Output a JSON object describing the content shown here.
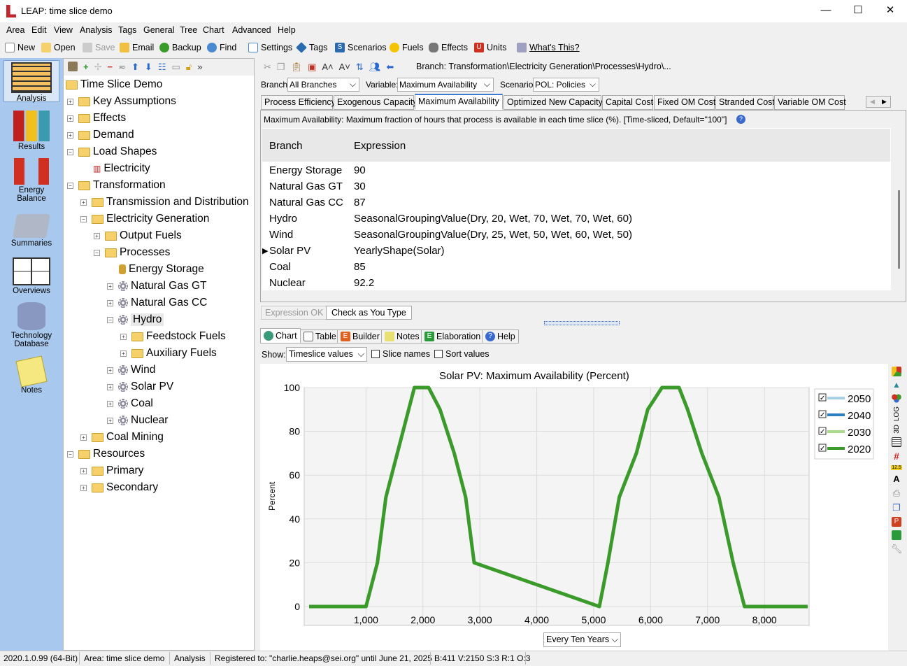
{
  "window": {
    "title": "LEAP: time slice demo",
    "minimize": "—",
    "maximize": "☐",
    "close": "✕"
  },
  "menu": [
    "Area",
    "Edit",
    "View",
    "Analysis",
    "Tags",
    "General",
    "Tree",
    "Chart",
    "Advanced",
    "Help"
  ],
  "toolbar": {
    "new": "New",
    "open": "Open",
    "save": "Save",
    "email": "Email",
    "backup": "Backup",
    "find": "Find",
    "settings": "Settings",
    "tags": "Tags",
    "scenarios": "Scenarios",
    "fuels": "Fuels",
    "effects": "Effects",
    "units": "Units",
    "whats_this": "What's This?"
  },
  "nav": {
    "analysis": "Analysis",
    "results": "Results",
    "energy_balance_1": "Energy",
    "energy_balance_2": "Balance",
    "summaries": "Summaries",
    "overviews": "Overviews",
    "techdb_1": "Technology",
    "techdb_2": "Database",
    "notes": "Notes"
  },
  "tree": {
    "root": "Time Slice Demo",
    "key_assumptions": "Key Assumptions",
    "effects": "Effects",
    "demand": "Demand",
    "load_shapes": "Load Shapes",
    "electricity": "Electricity",
    "transformation": "Transformation",
    "transmission": "Transmission and Distribution",
    "electricity_generation": "Electricity Generation",
    "output_fuels": "Output Fuels",
    "processes": "Processes",
    "energy_storage": "Energy Storage",
    "natural_gas_gt": "Natural Gas GT",
    "natural_gas_cc": "Natural Gas CC",
    "hydro": "Hydro",
    "feedstock_fuels": "Feedstock Fuels",
    "auxiliary_fuels": "Auxiliary Fuels",
    "wind": "Wind",
    "solar_pv": "Solar PV",
    "coal": "Coal",
    "nuclear": "Nuclear",
    "coal_mining": "Coal Mining",
    "resources": "Resources",
    "primary": "Primary",
    "secondary": "Secondary"
  },
  "breadcrumb": "Branch: Transformation\\Electricity Generation\\Processes\\Hydro\\...",
  "selectors": {
    "branch_label": "Branch:",
    "branch": "All Branches",
    "variable_label": "Variable:",
    "variable": "Maximum Availability",
    "scenario_label": "Scenario:",
    "scenario": "POL: Policies"
  },
  "tabs": [
    "Process Efficiency",
    "Exogenous Capacity",
    "Maximum Availability",
    "Optimized New Capacity",
    "Capital Cost",
    "Fixed OM Cost",
    "Stranded Cost",
    "Variable OM Cost"
  ],
  "description": "Maximum Availability: Maximum fraction of hours that process is available in each time slice (%). [Time-sliced, Default=\"100\"]",
  "grid": {
    "headers": [
      "Branch",
      "Expression"
    ],
    "rows": [
      [
        "Energy Storage",
        "90"
      ],
      [
        "Natural Gas GT",
        "30"
      ],
      [
        "Natural Gas CC",
        "87"
      ],
      [
        "Hydro",
        "SeasonalGroupingValue(Dry, 20, Wet, 70, Wet, 70, Wet, 60)"
      ],
      [
        "Wind",
        "SeasonalGroupingValue(Dry, 25, Wet, 50, Wet, 60, Wet, 50)"
      ],
      [
        "Solar PV",
        "YearlyShape(Solar)"
      ],
      [
        "Coal",
        "85"
      ],
      [
        "Nuclear",
        "92.2"
      ]
    ]
  },
  "expression_status": {
    "ok": "Expression OK",
    "check": "Check as You Type"
  },
  "bottom_tabs": [
    "Chart",
    "Table",
    "Builder",
    "Notes",
    "Elaboration",
    "Help"
  ],
  "chart_controls": {
    "show_label": "Show:",
    "show_value": "Timeslice values",
    "slice_names": "Slice names",
    "sort_values": "Sort values",
    "period": "Every Ten Years"
  },
  "side_icons": {
    "log": "LOG",
    "three_d": "3D",
    "num": "12.5"
  },
  "chart_data": {
    "type": "line",
    "title": "Solar PV: Maximum Availability (Percent)",
    "ylabel": "Percent",
    "xlabel": "",
    "xlim": [
      0,
      8760
    ],
    "ylim": [
      0,
      100
    ],
    "xticks": [
      "1,000",
      "2,000",
      "3,000",
      "4,000",
      "5,000",
      "6,000",
      "7,000",
      "8,000"
    ],
    "xtick_values": [
      1000,
      2000,
      3000,
      4000,
      5000,
      6000,
      7000,
      8000
    ],
    "yticks": [
      0,
      20,
      40,
      60,
      80,
      100
    ],
    "legend_position": "right",
    "series": [
      {
        "name": "2050",
        "color": "#a8d0e6",
        "values": []
      },
      {
        "name": "2040",
        "color": "#2a7fc0",
        "values": []
      },
      {
        "name": "2030",
        "color": "#a8dc8c",
        "values": []
      },
      {
        "name": "2020",
        "color": "#3a9a2a",
        "x": [
          0,
          1000,
          1200,
          1350,
          1550,
          1750,
          1850,
          2100,
          2300,
          2550,
          2750,
          2900,
          5100,
          5250,
          5450,
          5750,
          5950,
          6200,
          6500,
          6650,
          6900,
          7200,
          7450,
          7650,
          8760
        ],
        "values": [
          0,
          0,
          20,
          50,
          70,
          90,
          100,
          100,
          90,
          70,
          50,
          20,
          0,
          20,
          50,
          70,
          90,
          100,
          100,
          90,
          70,
          50,
          20,
          0,
          0
        ]
      }
    ]
  },
  "status": {
    "version": "2020.1.0.99 (64-Bit)",
    "area": "Area: time slice demo",
    "view": "Analysis",
    "registered": "Registered to: \"charlie.heaps@sei.org\" until June 21, 2025",
    "stats": "B:411 V:2150 S:3 R:1 O:3"
  }
}
